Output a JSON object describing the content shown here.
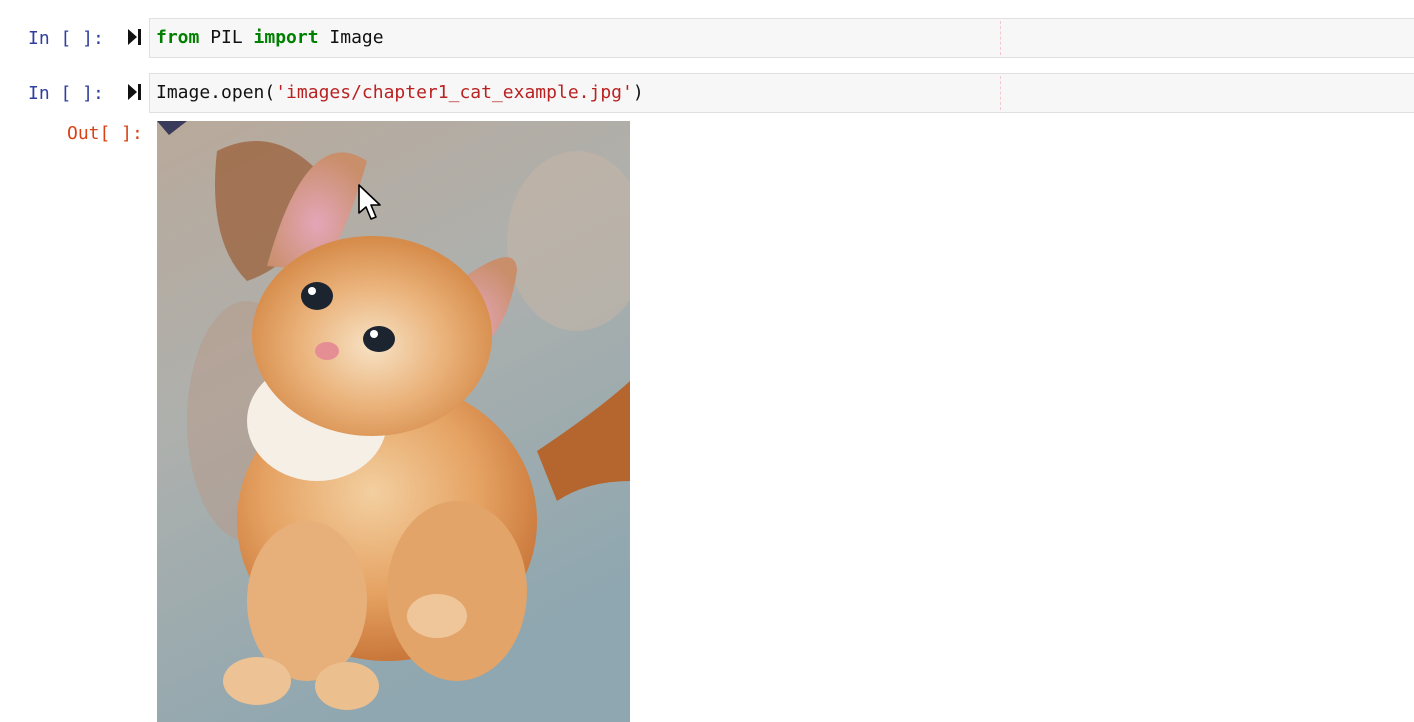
{
  "cells": [
    {
      "prompt": "In [ ]:",
      "code": {
        "kw1": "from",
        "mod": " PIL ",
        "kw2": "import",
        "name": " Image"
      }
    },
    {
      "prompt": "In [ ]:",
      "code": {
        "pre": "Image.open(",
        "str": "'images/chapter1_cat_example.jpg'",
        "post": ")"
      },
      "output_prompt": "Out[ ]:"
    }
  ],
  "icons": {
    "run": "run-cell-icon",
    "cursor": "mouse-pointer-icon"
  },
  "colors": {
    "prompt_in": "#303f9f",
    "prompt_out": "#d84315",
    "keyword": "#008000",
    "string": "#ba2121"
  }
}
